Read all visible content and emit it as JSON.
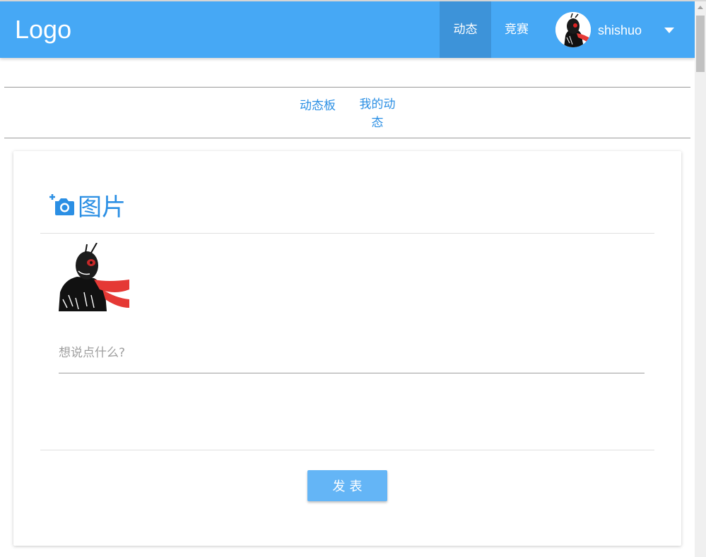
{
  "navbar": {
    "logo": "Logo",
    "items": [
      {
        "label": "动态",
        "active": true
      },
      {
        "label": "竞赛",
        "active": false
      }
    ],
    "username": "shishuo",
    "color": "#46a8f5",
    "active_color": "#3d93d9"
  },
  "subtabs": {
    "board": "动态板",
    "mine": "我的动态"
  },
  "post_form": {
    "image_label": "图片",
    "camera_icon": "add-photo-icon",
    "placeholder": "想说点什么?",
    "value": "",
    "submit_label": "发表",
    "accent_color": "#2b8fe4"
  }
}
